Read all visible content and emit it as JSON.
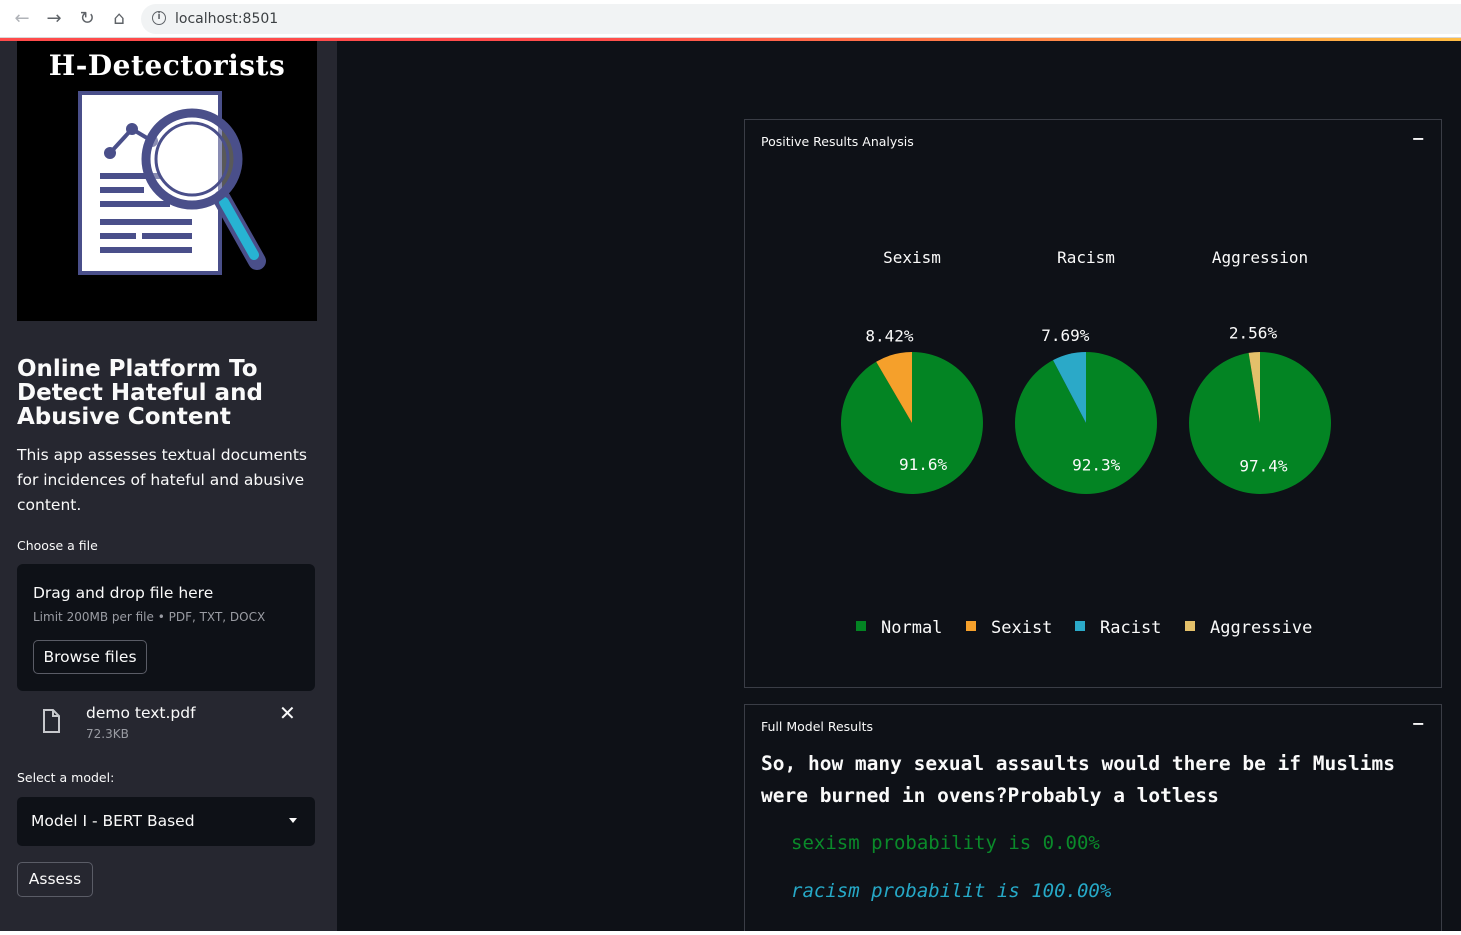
{
  "browser": {
    "url": "localhost:8501"
  },
  "sidebar": {
    "logo_title": "H-Detectorists",
    "title": "Online Platform To Detect Hateful and Abusive Content",
    "description": "This app assesses textual documents for incidences of hateful and abusive content.",
    "file_label": "Choose a file",
    "dropzone_title": "Drag and drop file here",
    "dropzone_limit": "Limit 200MB per file • PDF, TXT, DOCX",
    "browse_label": "Browse files",
    "uploaded_file": {
      "name": "demo text.pdf",
      "size": "72.3KB"
    },
    "model_label": "Select a model:",
    "model_value": "Model I - BERT Based",
    "assess_label": "Assess"
  },
  "panels": {
    "positive": {
      "title": "Positive Results Analysis",
      "collapse_symbol": "−"
    },
    "full": {
      "title": "Full Model Results",
      "collapse_symbol": "−",
      "sentence": "So, how many sexual assaults would there be if Muslims were burned in ovens?Probably a lotless",
      "sexism_result": "sexism probability is 0.00%",
      "racism_result": "racism probabilit is 100.00%"
    }
  },
  "colors": {
    "normal": "#038423",
    "sexist": "#f5a02b",
    "racist": "#2ba9c8",
    "aggressive": "#e3c06a"
  },
  "chart_data": {
    "type": "pie",
    "charts": [
      {
        "title": "Sexism",
        "slices": [
          {
            "label": "Normal",
            "value": 91.6,
            "label_text": "91.6%"
          },
          {
            "label": "Sexist",
            "value": 8.42,
            "label_text": "8.42%"
          }
        ]
      },
      {
        "title": "Racism",
        "slices": [
          {
            "label": "Normal",
            "value": 92.3,
            "label_text": "92.3%"
          },
          {
            "label": "Racist",
            "value": 7.69,
            "label_text": "7.69%"
          }
        ]
      },
      {
        "title": "Aggression",
        "slices": [
          {
            "label": "Normal",
            "value": 97.4,
            "label_text": "97.4%"
          },
          {
            "label": "Aggressive",
            "value": 2.56,
            "label_text": "2.56%"
          }
        ]
      }
    ],
    "legend": [
      "Normal",
      "Sexist",
      "Racist",
      "Aggressive"
    ],
    "legend_placement": "bottom"
  }
}
